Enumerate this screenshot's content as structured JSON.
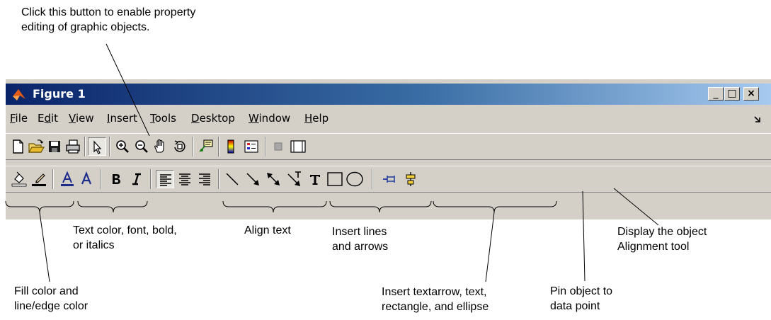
{
  "window": {
    "title": "Figure 1",
    "minimize": "_",
    "maximize": "□",
    "close": "×"
  },
  "menu": [
    "File",
    "Edit",
    "View",
    "Insert",
    "Tools",
    "Desktop",
    "Window",
    "Help"
  ],
  "menu_underline_index": [
    0,
    1,
    0,
    0,
    0,
    0,
    0,
    0
  ],
  "toolbar1_icons": [
    "new-file-icon",
    "open-folder-icon",
    "save-icon",
    "print-icon",
    "edit-plot-arrow-icon",
    "zoom-in-icon",
    "zoom-out-icon",
    "pan-hand-icon",
    "rotate-3d-icon",
    "data-cursor-icon",
    "colorbar-icon",
    "legend-icon",
    "hide-plot-tools-icon",
    "show-plot-tools-icon"
  ],
  "toolbar2_icons": [
    "fill-color-icon",
    "edge-color-icon",
    "text-color-icon",
    "font-icon",
    "bold-icon",
    "italic-icon",
    "align-left-icon",
    "align-center-icon",
    "align-right-icon",
    "line-icon",
    "arrow-icon",
    "double-arrow-icon",
    "text-arrow-icon",
    "text-icon",
    "rectangle-icon",
    "ellipse-icon",
    "pin-icon",
    "align-distribute-icon"
  ],
  "annotations": {
    "edit_button": [
      "Click this button to enable property",
      "editing of graphic objects."
    ],
    "text_format": [
      "Text color, font, bold,",
      "or italics"
    ],
    "align_text": [
      "Align text"
    ],
    "lines_arrows": [
      "Insert lines",
      "and arrows"
    ],
    "display_align": [
      "Display the object",
      "Alignment tool"
    ],
    "fill_color": [
      "Fill color and",
      "line/edge color"
    ],
    "insert_shapes": [
      "Insert textarrow, text,",
      "rectangle, and ellipse"
    ],
    "pin_object": [
      "Pin object to",
      "data point"
    ]
  },
  "colors": {
    "titlebar_start": "#0a246a",
    "titlebar_end": "#a6caf0",
    "face": "#d4d0c8"
  }
}
